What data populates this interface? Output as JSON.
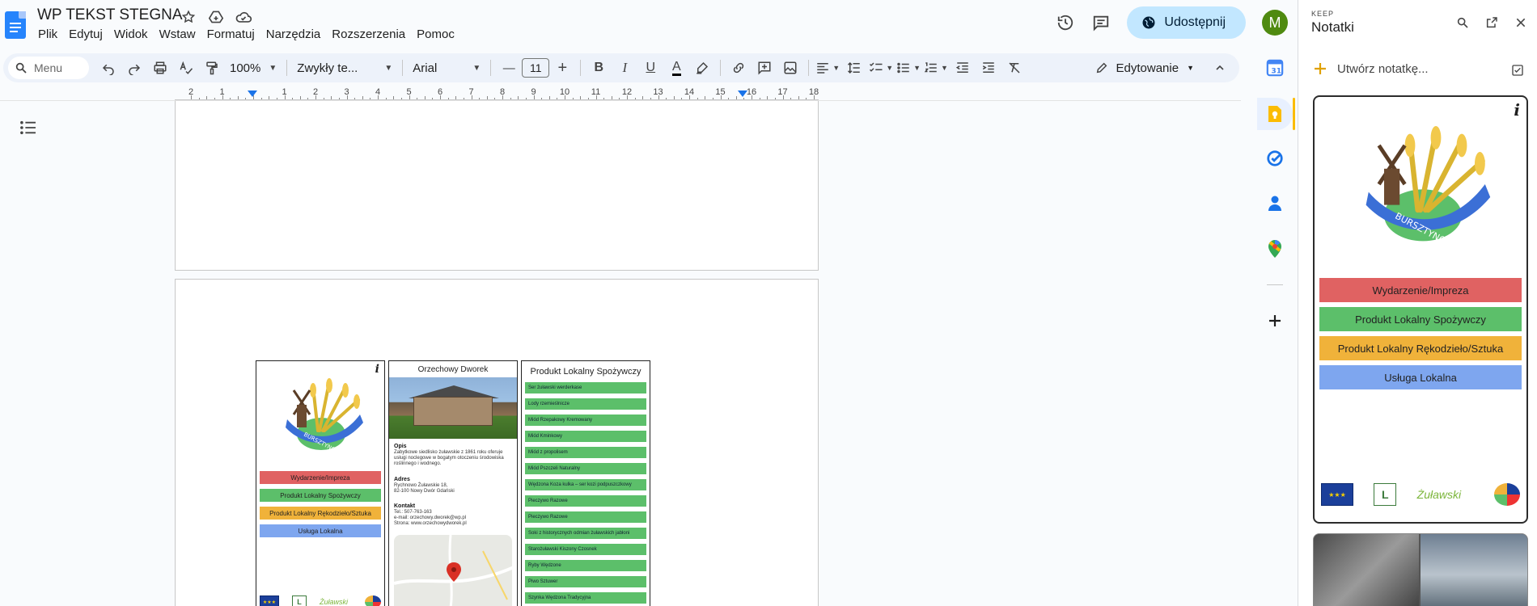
{
  "app": {
    "doc_title": "WP TEKST STEGNA",
    "menu": [
      "Plik",
      "Edytuj",
      "Widok",
      "Wstaw",
      "Formatuj",
      "Narzędzia",
      "Rozszerzenia",
      "Pomoc"
    ],
    "share_label": "Udostępnij",
    "avatar_letter": "M"
  },
  "toolbar": {
    "search_placeholder": "Menu",
    "zoom": "100%",
    "style": "Zwykły te...",
    "font": "Arial",
    "font_size": "11",
    "mode": "Edytowanie"
  },
  "ruler": {
    "labels": [
      "2",
      "1",
      "",
      "1",
      "2",
      "3",
      "4",
      "5",
      "6",
      "7",
      "8",
      "9",
      "10",
      "11",
      "12",
      "13",
      "14",
      "15",
      "16",
      "17",
      "18"
    ]
  },
  "doc_cards": {
    "categories": [
      "Wydarzenie/Impreza",
      "Produkt Lokalny Spożywczy",
      "Produkt Lokalny Rękodzieło/Sztuka",
      "Usługa Lokalna"
    ],
    "info_mark": "i",
    "logo_text": "BURSZTYNOWY CZAS",
    "zulawski_text": "Żuławski",
    "dworek": {
      "title": "Orzechowy Dworek",
      "opis_label": "Opis",
      "opis_text": "Zabytkowe siedlisko żuławskie z 1861 roku oferuje usługi noclegowe w bogatym otoczeniu środowiska roślinnego i wodnego.",
      "adres_label": "Adres",
      "adres_line1": "Rychnowo Żuławskie 18,",
      "adres_line2": "82-100 Nowy Dwór Gdański",
      "kontakt_label": "Kontakt",
      "tel": "Tel.: 507-763-163",
      "email": "e-mail: orzechowy.dworek@wp.pl",
      "strona": "Strona: www.orzechowydworek.pl"
    },
    "produkty": {
      "title": "Produkt Lokalny Spożywczy",
      "items": [
        "Ser żuławski werderkase",
        "Lody rzemieślnicze",
        "Miód Rzepakowy Kremowany",
        "Miód Kminkowy",
        "Miód z propolisem",
        "Miód Pszczeli Naturalny",
        "Wędzona Koza kulka – ser kozi podpuszczkowy",
        "Pieczywo Razowe",
        "Pieczywo Razowe",
        "Soki z historycznych odmian żuławskich jabłoni",
        "Starożuławski Kiszony Czosnek",
        "Ryby Wędzone",
        "Piwo Sztuwer",
        "Szynka Wędzona Tradycyjna"
      ]
    }
  },
  "keep": {
    "label": "KEEP",
    "title": "Notatki",
    "create_label": "Utwórz notatkę..."
  }
}
